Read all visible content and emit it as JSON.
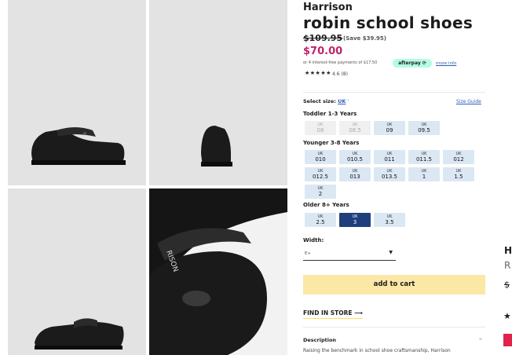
{
  "product": {
    "brand": "Harrison",
    "title": "robin school shoes",
    "was_price": "$109.95",
    "save": "(Save $39.95)",
    "price": "$70.00",
    "afterpay_text": "or 4 interest-free payments of $17.50",
    "afterpay_badge": "afterpay",
    "afterpay_more": "more info",
    "stars": "★★★★★",
    "rating": "4.6 (8)"
  },
  "size": {
    "label": "Select size:",
    "system": "UK",
    "guide": "Size Guide",
    "groups": [
      {
        "title": "Toddler 1-3 Years"
      },
      {
        "title": "Younger 3-8 Years"
      },
      {
        "title": "Older 8+ Years"
      }
    ],
    "unit": "UK",
    "sizes": [
      "08",
      "08.5",
      "09",
      "09.5",
      "010",
      "010.5",
      "011",
      "011.5",
      "012",
      "012.5",
      "013",
      "013.5",
      "1",
      "1.5",
      "2",
      "2.5",
      "3",
      "3.5"
    ]
  },
  "width": {
    "label": "Width:",
    "value": "E+"
  },
  "cart": {
    "label": "add to cart"
  },
  "store": {
    "label": "FIND IN STORE",
    "arrow": "⟶"
  },
  "description": {
    "title": "Description",
    "toggle": "–",
    "text": "Raising the benchmark in school shoe craftsmanship, Harrison"
  },
  "adjacent": {
    "brand": "H",
    "title": "R",
    "price": "$",
    "star": "★"
  },
  "icons": [
    "chevron-down-icon",
    "star-icon",
    "arrow-right-icon",
    "minus-icon"
  ],
  "colors": {
    "price": "#c1246b",
    "selected": "#1f3f7c",
    "size_bg": "#dbe8f3",
    "cart": "#fbe8a6",
    "link": "#2b5fb8"
  }
}
